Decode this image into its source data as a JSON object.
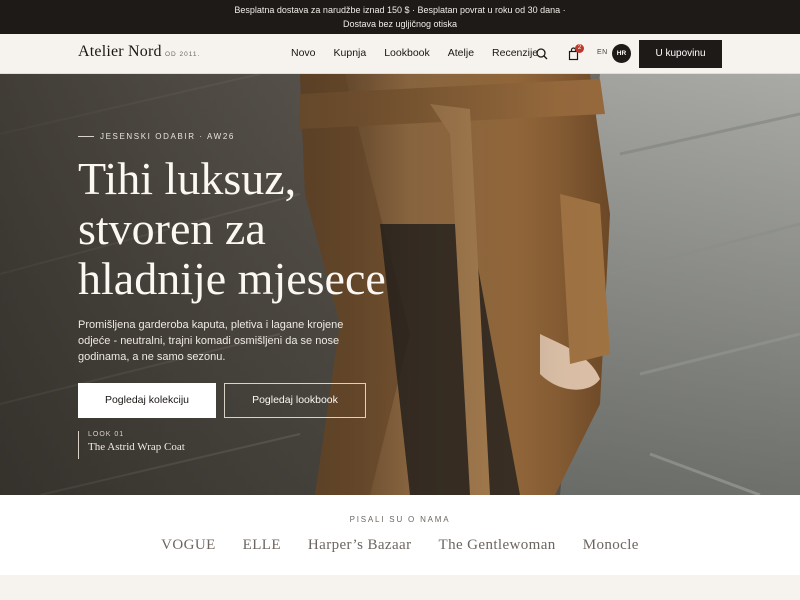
{
  "announcement": {
    "line1": "Besplatna dostava za narudžbe iznad 150 $ · Besplatan povrat u roku od 30 dana ·",
    "line2": "Dostava bez ugljičnog otiska"
  },
  "brand": {
    "name": "Atelier Nord",
    "est": "OD 2011."
  },
  "nav": {
    "links": [
      "Novo",
      "Kupnja",
      "Lookbook",
      "Atelje",
      "Recenzije"
    ],
    "cart_count": "2",
    "lang_en": "EN",
    "lang_hr": "HR",
    "cta": "U kupovinu"
  },
  "hero": {
    "eyebrow": "JESENSKI ODABIR · AW26",
    "headline": [
      "Tihi luksuz,",
      "stvoren za",
      "hladnije mjesece"
    ],
    "lead": "Promišljena garderoba kaputa, pletiva i lagane krojene odjeće - neutralni, trajni komadi osmišljeni da se nose godinama, a ne samo sezonu.",
    "primary_cta": "Pogledaj kolekciju",
    "secondary_cta": "Pogledaj lookbook",
    "look_label": "LOOK 01",
    "look_name": "The Astrid Wrap Coat"
  },
  "press": {
    "title": "PISALI SU O NAMA",
    "logos": [
      "VOGUE",
      "ELLE",
      "Harper’s Bazaar",
      "The Gentlewoman",
      "Monocle"
    ]
  },
  "icons": {
    "search": "search-icon",
    "cart": "shopping-bag-icon"
  },
  "colors": {
    "dark": "#1e1a18",
    "cream": "#f6f3ee",
    "coat": "#a87a4b",
    "badge": "#c0392b"
  }
}
